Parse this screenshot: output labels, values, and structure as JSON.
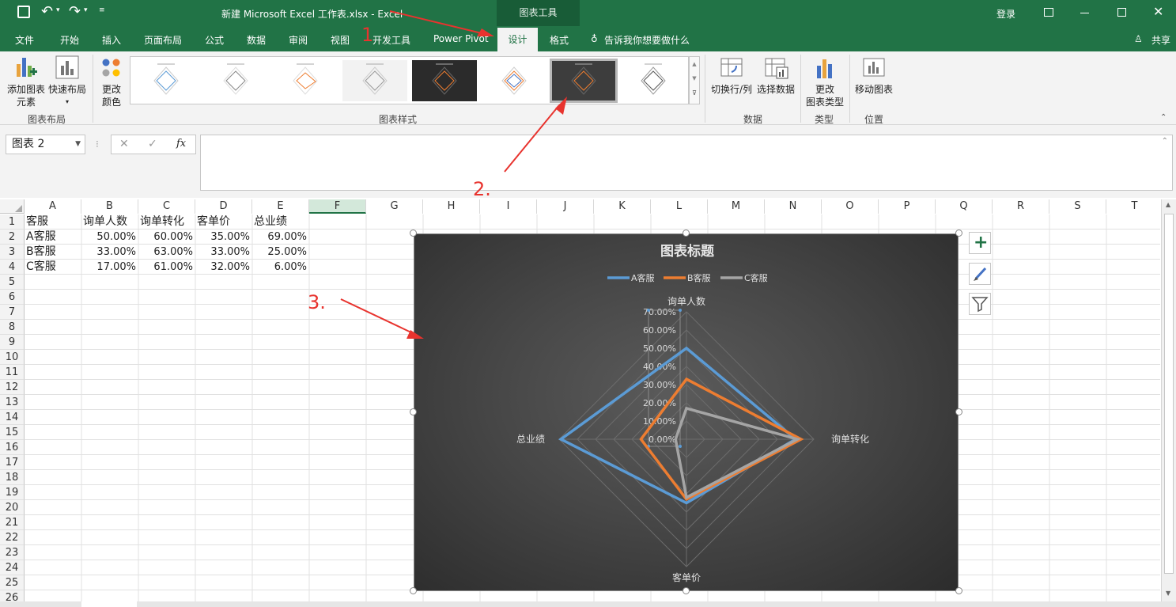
{
  "titlebar": {
    "title": "新建 Microsoft Excel 工作表.xlsx  -  Excel",
    "context_tab_group": "图表工具",
    "login": "登录"
  },
  "tabs": {
    "file": "文件",
    "home": "开始",
    "insert": "插入",
    "layout": "页面布局",
    "formulas": "公式",
    "data": "数据",
    "review": "审阅",
    "view": "视图",
    "developer": "开发工具",
    "powerpivot": "Power Pivot",
    "design": "设计",
    "format": "格式",
    "tellme": "告诉我你想要做什么",
    "share": "共享"
  },
  "ribbon": {
    "add_element_l1": "添加图表",
    "add_element_l2": "元素",
    "quick_layout": "快速布局",
    "change_color_l1": "更改",
    "change_color_l2": "颜色",
    "group_layout": "图表布局",
    "group_styles": "图表样式",
    "switch_rowcol": "切换行/列",
    "select_data": "选择数据",
    "group_data": "数据",
    "change_type_l1": "更改",
    "change_type_l2": "图表类型",
    "group_type": "类型",
    "move_chart": "移动图表",
    "group_location": "位置"
  },
  "formula_bar": {
    "name_box": "图表 2",
    "fx": "fx"
  },
  "columns": [
    "A",
    "B",
    "C",
    "D",
    "E",
    "F",
    "G",
    "H",
    "I",
    "J",
    "K",
    "L",
    "M",
    "N",
    "O",
    "P",
    "Q",
    "R",
    "S",
    "T"
  ],
  "rows": [
    "1",
    "2",
    "3",
    "4",
    "5",
    "6",
    "7",
    "8",
    "9",
    "10",
    "11",
    "12",
    "13",
    "14",
    "15",
    "16",
    "17",
    "18",
    "19",
    "20",
    "21",
    "22",
    "23",
    "24",
    "25",
    "26"
  ],
  "sheet": {
    "header": [
      "客服",
      "询单人数",
      "询单转化",
      "客单价",
      "总业绩"
    ],
    "data": [
      [
        "A客服",
        "50.00%",
        "60.00%",
        "35.00%",
        "69.00%"
      ],
      [
        "B客服",
        "33.00%",
        "63.00%",
        "33.00%",
        "25.00%"
      ],
      [
        "C客服",
        "17.00%",
        "61.00%",
        "32.00%",
        "6.00%"
      ]
    ]
  },
  "annotations": {
    "a1": "1",
    "a2": "2.",
    "a3": "3."
  },
  "chart_data": {
    "type": "radar",
    "title": "图表标题",
    "categories": [
      "询单人数",
      "询单转化",
      "客单价",
      "总业绩"
    ],
    "series": [
      {
        "name": "A客服",
        "values": [
          50,
          60,
          35,
          69
        ],
        "color": "#5b9bd5"
      },
      {
        "name": "B客服",
        "values": [
          33,
          63,
          33,
          25
        ],
        "color": "#ed7d31"
      },
      {
        "name": "C客服",
        "values": [
          17,
          61,
          32,
          6
        ],
        "color": "#a5a5a5"
      }
    ],
    "ticks": [
      "0.00%",
      "10.00%",
      "20.00%",
      "30.00%",
      "40.00%",
      "50.00%",
      "60.00%",
      "70.00%"
    ],
    "rmax": 70,
    "legend_position": "top",
    "background": "dark"
  }
}
